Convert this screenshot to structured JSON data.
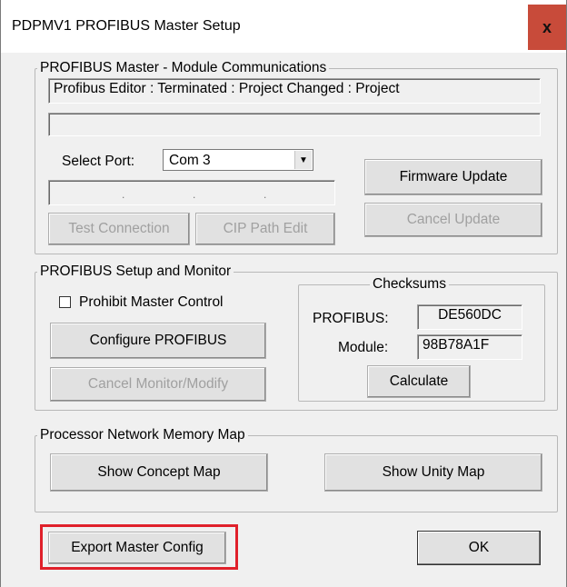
{
  "window": {
    "title": "PDPMV1 PROFIBUS Master Setup",
    "close_glyph": "x"
  },
  "comm": {
    "legend": "PROFIBUS Master - Module Communications",
    "status_text": "Profibus Editor : Terminated : Project Changed : Project",
    "path_text": "",
    "select_port_label": "Select Port:",
    "port_value": "Com 3",
    "ip_dots": [
      ".",
      ".",
      "."
    ],
    "firmware_update": "Firmware Update",
    "cancel_update": "Cancel Update",
    "test_connection": "Test Connection",
    "cip_path_edit": "CIP Path Edit"
  },
  "setup": {
    "legend": "PROFIBUS Setup and Monitor",
    "prohibit_label": "Prohibit Master Control",
    "prohibit_checked": false,
    "configure": "Configure PROFIBUS",
    "cancel_monitor": "Cancel Monitor/Modify",
    "checksums": {
      "legend": "Checksums",
      "profibus_label": "PROFIBUS:",
      "profibus_value": "DE560DC",
      "module_label": "Module:",
      "module_value": "98B78A1F",
      "calculate": "Calculate"
    }
  },
  "memmap": {
    "legend": "Processor Network Memory Map",
    "show_concept": "Show Concept Map",
    "show_unity": "Show Unity Map"
  },
  "footer": {
    "export": "Export Master Config",
    "ok": "OK"
  },
  "colors": {
    "close_bg": "#c84b3a",
    "highlight": "#e0202a"
  },
  "icons": {
    "close": "close-icon",
    "combo_arrow": "chevron-down-icon"
  }
}
